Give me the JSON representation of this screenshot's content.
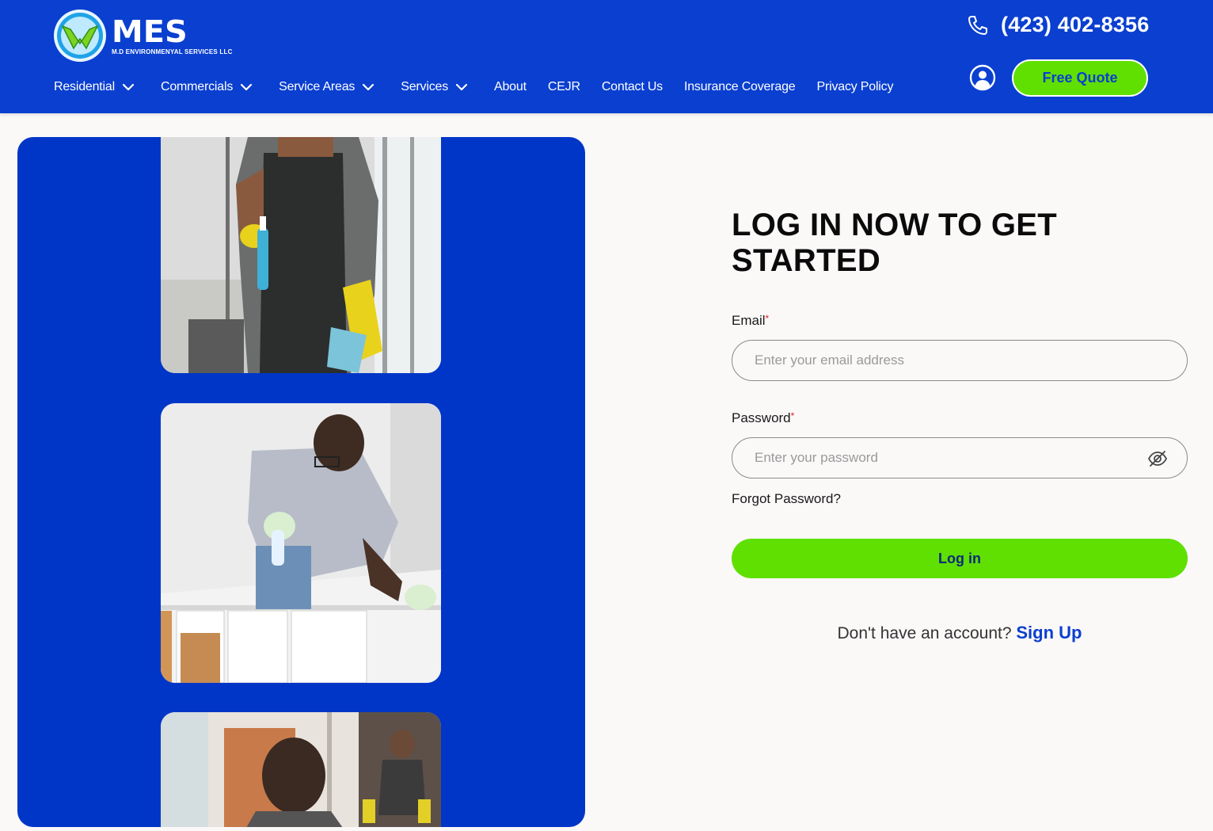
{
  "header": {
    "logo": {
      "name": "MES",
      "subtitle": "M.D ENVIRONMENYAL SERVICES LLC"
    },
    "phone": "(423) 402-8356",
    "quote_button": "Free Quote",
    "nav": [
      {
        "label": "Residential",
        "dropdown": true
      },
      {
        "label": "Commercials",
        "dropdown": true
      },
      {
        "label": "Service Areas",
        "dropdown": true
      },
      {
        "label": "Services",
        "dropdown": true
      },
      {
        "label": "About",
        "dropdown": false
      },
      {
        "label": "CEJR",
        "dropdown": false
      },
      {
        "label": "Contact Us",
        "dropdown": false
      },
      {
        "label": "Insurance Coverage",
        "dropdown": false
      },
      {
        "label": "Privacy Policy",
        "dropdown": false
      }
    ]
  },
  "login": {
    "title": "LOG IN NOW TO GET STARTED",
    "email_label": "Email",
    "email_placeholder": "Enter your email address",
    "password_label": "Password",
    "password_placeholder": "Enter your password",
    "required_mark": "*",
    "forgot": "Forgot Password?",
    "button": "Log in",
    "signup_prompt": "Don't have an account?",
    "signup_link": "Sign Up"
  },
  "colors": {
    "brand_blue": "#0a3fd0",
    "accent_green": "#5fe000",
    "page_bg": "#fbf8f8"
  },
  "icons": {
    "phone": "phone-icon",
    "user": "user-circle-icon",
    "password_toggle": "eye-slash-icon",
    "dropdown": "chevron-down-icon"
  }
}
